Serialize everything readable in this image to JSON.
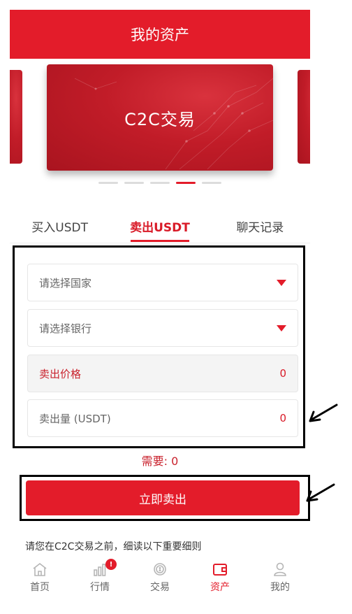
{
  "header": {
    "title": "我的资产"
  },
  "carousel": {
    "active_card_title": "C2C交易"
  },
  "tabs": [
    {
      "label": "买入USDT"
    },
    {
      "label": "卖出USDT"
    },
    {
      "label": "聊天记录"
    }
  ],
  "form": {
    "country_placeholder": "请选择国家",
    "bank_placeholder": "请选择银行",
    "price_label": "卖出价格",
    "price_value": "0",
    "amount_label": "卖出量 (USDT)",
    "amount_value": "0"
  },
  "need": {
    "text": "需要: 0"
  },
  "sell_button": {
    "label": "立即卖出"
  },
  "notice": {
    "text": "请您在C2C交易之前，细读以下重要细则"
  },
  "bottom_nav": [
    {
      "label": "首页",
      "icon": "home-icon"
    },
    {
      "label": "行情",
      "icon": "chart-icon",
      "badge": "!"
    },
    {
      "label": "交易",
      "icon": "exchange-icon"
    },
    {
      "label": "资产",
      "icon": "wallet-icon"
    },
    {
      "label": "我的",
      "icon": "user-icon"
    }
  ],
  "colors": {
    "primary": "#e31c2a",
    "text_red": "#c9222d"
  }
}
